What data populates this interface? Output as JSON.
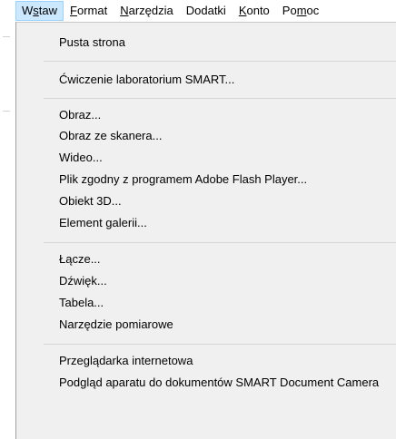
{
  "menubar": {
    "items": [
      {
        "label": "Wstaw"
      },
      {
        "label": "Format"
      },
      {
        "label": "Narzędzia"
      },
      {
        "label": "Dodatki"
      },
      {
        "label": "Konto"
      },
      {
        "label": "Pomoc"
      }
    ]
  },
  "dropdown": {
    "groups": [
      [
        "Pusta strona"
      ],
      [
        "Ćwiczenie laboratorium SMART..."
      ],
      [
        "Obraz...",
        "Obraz ze skanera...",
        "Wideo...",
        "Plik zgodny z programem Adobe Flash Player...",
        "Obiekt 3D...",
        "Element galerii..."
      ],
      [
        "Łącze...",
        "Dźwięk...",
        "Tabela...",
        "Narzędzie pomiarowe"
      ],
      [
        "Przeglądarka internetowa",
        "Podgląd aparatu do dokumentów SMART Document Camera"
      ]
    ]
  }
}
